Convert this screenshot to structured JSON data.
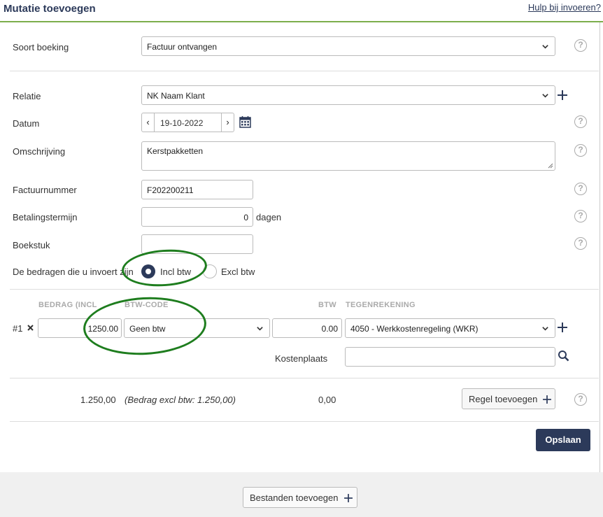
{
  "header": {
    "title": "Mutatie toevoegen",
    "help_link": "Hulp bij invoeren?"
  },
  "form": {
    "soort_boeking": {
      "label": "Soort boeking",
      "value": "Factuur ontvangen"
    },
    "relatie": {
      "label": "Relatie",
      "value": "NK Naam Klant"
    },
    "datum": {
      "label": "Datum",
      "value": "19-10-2022"
    },
    "omschrijving": {
      "label": "Omschrijving",
      "value": "Kerstpakketten"
    },
    "factuurnummer": {
      "label": "Factuurnummer",
      "value": "F202200211"
    },
    "betalingstermijn": {
      "label": "Betalingstermijn",
      "value": "0",
      "unit": "dagen"
    },
    "boekstuk": {
      "label": "Boekstuk",
      "value": ""
    },
    "bedragen": {
      "label": "De bedragen die u invoert zijn",
      "incl": "Incl btw",
      "excl": "Excl btw",
      "selected": "incl"
    }
  },
  "lines": {
    "headers": {
      "bedrag": "BEDRAG (INCL",
      "btw_code": "BTW-CODE",
      "btw": "BTW",
      "tegenrekening": "TEGENREKENING"
    },
    "rows": [
      {
        "num": "#1",
        "bedrag": "1250.00",
        "btw_code": "Geen btw",
        "btw": "0.00",
        "tegenrekening": "4050 - Werkkostenregeling (WKR)",
        "kostenplaats_label": "Kostenplaats",
        "kostenplaats": ""
      }
    ]
  },
  "totals": {
    "total": "1.250,00",
    "excl_note": "(Bedrag excl btw: 1.250,00)",
    "btw_total": "0,00",
    "add_line": "Regel toevoegen"
  },
  "actions": {
    "save": "Opslaan",
    "add_files": "Bestanden toevoegen"
  },
  "colors": {
    "accent": "#2c3a5a",
    "header_line": "#7cae4c",
    "annotation": "#1e7d1e"
  }
}
